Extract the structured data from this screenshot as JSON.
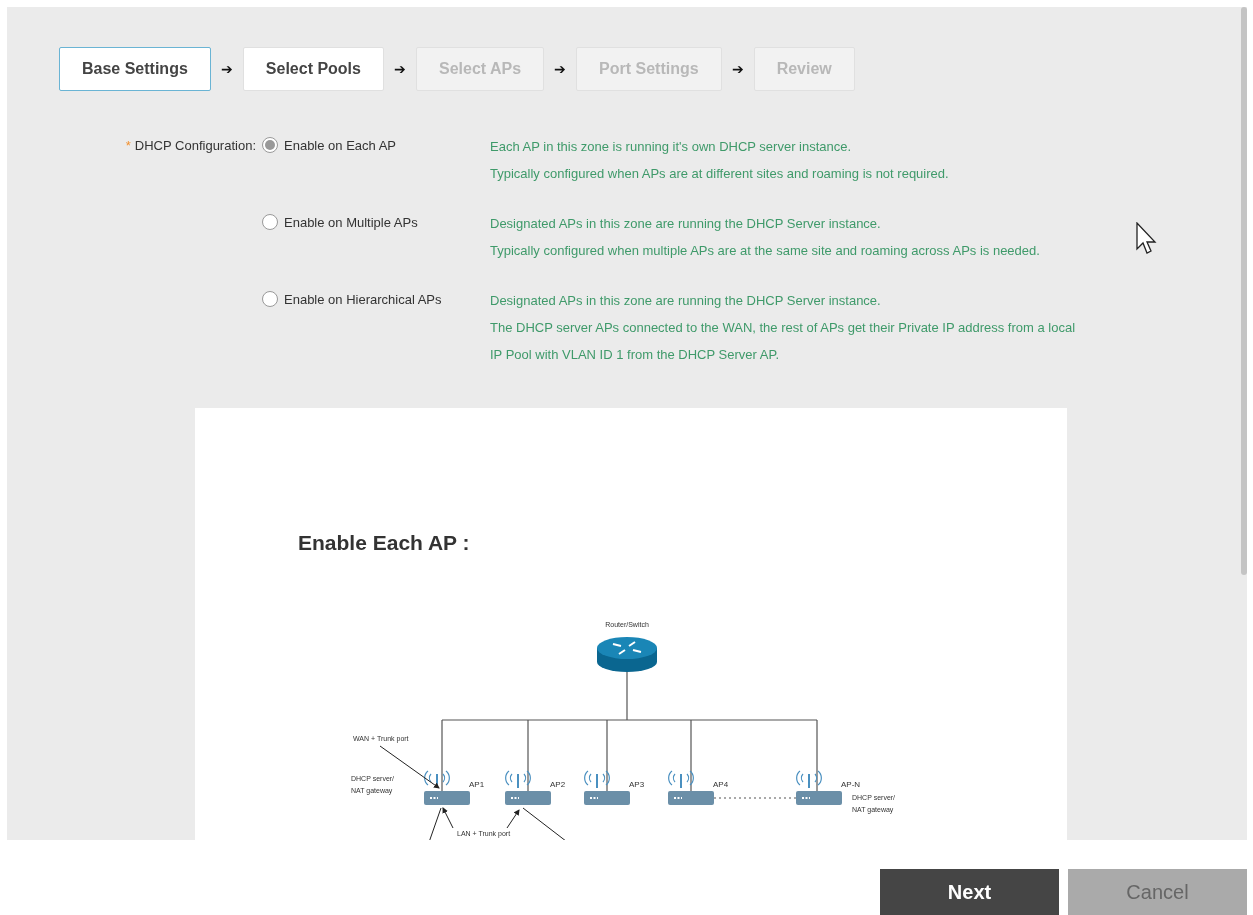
{
  "steps": [
    {
      "label": "Base Settings",
      "selected": true,
      "disabled": false
    },
    {
      "label": "Select Pools",
      "selected": false,
      "disabled": false
    },
    {
      "label": "Select APs",
      "selected": false,
      "disabled": true
    },
    {
      "label": "Port Settings",
      "selected": false,
      "disabled": true
    },
    {
      "label": "Review",
      "selected": false,
      "disabled": true
    }
  ],
  "step_separator": "➔",
  "dhcp": {
    "required_mark": "*",
    "label": "DHCP Configuration:",
    "options": [
      {
        "label": "Enable on Each AP",
        "selected": true,
        "description": [
          "Each AP in this zone is running it's own DHCP server instance.",
          "Typically configured when APs are at different sites and roaming is not required."
        ]
      },
      {
        "label": "Enable on Multiple APs",
        "selected": false,
        "description": [
          "Designated APs in this zone are running the DHCP Server instance.",
          "Typically configured when multiple APs are at the same site and roaming across APs is needed."
        ]
      },
      {
        "label": "Enable on Hierarchical APs",
        "selected": false,
        "description": [
          "Designated APs in this zone are running the DHCP Server instance.",
          "The DHCP server APs connected to the WAN, the rest of APs get their Private IP address from a local",
          "IP Pool with VLAN ID 1 from the DHCP Server AP."
        ]
      }
    ]
  },
  "diagram": {
    "title": "Enable Each AP :",
    "router_label": "Router/Switch",
    "wan_label": "WAN + Trunk port",
    "lan_label": "LAN + Trunk port",
    "gateway_label_left": [
      "DHCP server/",
      "NAT gateway"
    ],
    "gateway_label_right": [
      "DHCP server/",
      "NAT gateway"
    ],
    "aps": [
      "AP1",
      "AP2",
      "AP3",
      "AP4",
      "AP-N"
    ]
  },
  "buttons": [
    {
      "label": "Next",
      "kind": "primary"
    },
    {
      "label": "Cancel",
      "kind": "secondary"
    }
  ]
}
